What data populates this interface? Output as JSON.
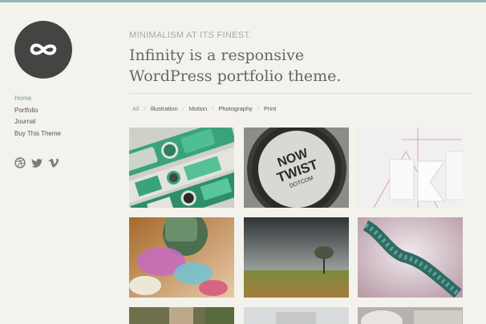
{
  "colors": {
    "accent": "#8fb6b8",
    "nav_active": "#6e9fa2",
    "logo_bg": "#444443",
    "background": "#f4f2ec"
  },
  "logo": {
    "icon": "infinity-icon"
  },
  "nav": {
    "items": [
      {
        "label": "Home",
        "active": true
      },
      {
        "label": "Portfolio",
        "active": false
      },
      {
        "label": "Journal",
        "active": false
      },
      {
        "label": "Buy This Theme",
        "active": false
      }
    ]
  },
  "social": {
    "icons": [
      "dribbble-icon",
      "twitter-icon",
      "vimeo-icon"
    ]
  },
  "header": {
    "tagline": "MINIMALISM AT ITS FINEST.",
    "title_line1": "Infinity is a responsive",
    "title_line2": "WordPress portfolio theme."
  },
  "filters": {
    "items": [
      {
        "label": "All",
        "active": true
      },
      {
        "label": "Illustration",
        "active": false
      },
      {
        "label": "Motion",
        "active": false
      },
      {
        "label": "Photography",
        "active": false
      },
      {
        "label": "Print",
        "active": false
      }
    ]
  },
  "portfolio": {
    "thumbs": [
      {
        "subject": "green retro electronic illustration"
      },
      {
        "subject": "Now Twist badge print",
        "badge_line1": "NOW",
        "badge_line2": "TWIST",
        "badge_line3": "DOTCOM"
      },
      {
        "subject": "white embossed paper print"
      },
      {
        "subject": "colorful 3D motion render"
      },
      {
        "subject": "lone tree landscape photograph"
      },
      {
        "subject": "twisted rope 3D render"
      }
    ]
  }
}
